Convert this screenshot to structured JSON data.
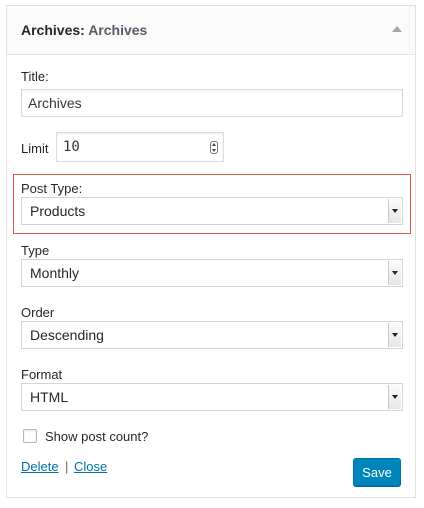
{
  "widget": {
    "title_prefix": "Archives:",
    "title_instance": "Archives"
  },
  "form": {
    "title": {
      "label": "Title:",
      "value": "Archives"
    },
    "limit": {
      "label": "Limit",
      "value": "10"
    },
    "post_type": {
      "label": "Post Type:",
      "value": "Products"
    },
    "type": {
      "label": "Type",
      "value": "Monthly"
    },
    "order": {
      "label": "Order",
      "value": "Descending"
    },
    "format": {
      "label": "Format",
      "value": "HTML"
    },
    "show_count": {
      "label": "Show post count?",
      "checked": false
    }
  },
  "actions": {
    "delete": "Delete",
    "separator": "|",
    "close": "Close",
    "save": "Save"
  },
  "colors": {
    "highlight_border": "#e8583b",
    "primary_button": "#0085ba",
    "link": "#0073aa"
  },
  "icons": {
    "collapse": "triangle-up-icon",
    "select": "dropdown-arrow-icon",
    "number": "stepper-icon"
  }
}
